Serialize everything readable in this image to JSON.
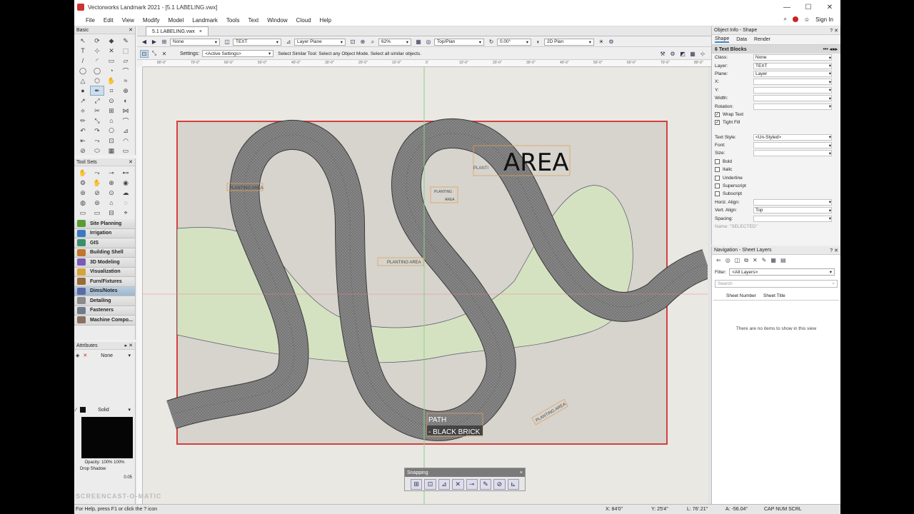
{
  "window": {
    "title": "Vectorworks Landmark 2021 - [5.1 LABELING.vwx]",
    "controls": [
      "—",
      "☐",
      "✕"
    ]
  },
  "menu": [
    "File",
    "Edit",
    "View",
    "Modify",
    "Model",
    "Landmark",
    "Tools",
    "Text",
    "Window",
    "Cloud",
    "Help"
  ],
  "menu_right": {
    "sign_in": "Sign In"
  },
  "document_tab": {
    "label": "5.1 LABELING.vwx",
    "close": "×"
  },
  "view_bar": {
    "class": "None",
    "layer": "TEXT",
    "plane": "Layer Plane",
    "zoom": "62%",
    "view": "Top/Plan",
    "rotation": "0.00°",
    "render": "2D Plan"
  },
  "mode_bar": {
    "settings_label": "Settings:",
    "settings_value": "<Active Settings>",
    "hint": "Select Similar Tool: Select any Object Mode. Select all similar objects."
  },
  "ruler_labels": [
    "80'-0\"",
    "70'-0\"",
    "60'-0\"",
    "50'-0\"",
    "40'-0\"",
    "30'-0\"",
    "20'-0\"",
    "10'-0\"",
    "0'",
    "10'-0\"",
    "20'-0\"",
    "30'-0\"",
    "40'-0\"",
    "50'-0\"",
    "60'-0\"",
    "70'-0\"",
    "80'-0\""
  ],
  "basic_palette": {
    "title": "Basic",
    "tools": [
      "↖",
      "⟳",
      "◆",
      "✎",
      "T",
      "⊹",
      "✕",
      "⬚",
      "/",
      "◜",
      "▭",
      "▱",
      "◯",
      "◯",
      "◔",
      "⌒",
      "△",
      "⬡",
      "✋",
      "≈",
      "●",
      "✒",
      "⌗",
      "⊕",
      "↗",
      "⤢",
      "⊙",
      "◐",
      "⟡",
      "✂",
      "⊞",
      "⋈",
      "✏",
      "⤡",
      "⌂",
      "⌒",
      "↶",
      "↷",
      "⎔",
      "⊿",
      "⇤",
      "⤳",
      "⊡",
      "◠",
      "⊘",
      "⬭",
      "▦",
      "▭"
    ]
  },
  "tool_sets": {
    "title": "Tool Sets",
    "tools": [
      "✋",
      "⤳",
      "⊸",
      "⊷",
      "⚙",
      "✋",
      "⊕",
      "◉",
      "⊛",
      "⊘",
      "⊙",
      "☁",
      "◍",
      "⊜",
      "⌂",
      "◌",
      "▭",
      "▭",
      "⊟",
      "⌖"
    ],
    "items": [
      {
        "label": "Site Planning",
        "color": "#5a9a3a"
      },
      {
        "label": "Irrigation",
        "color": "#3a7abf"
      },
      {
        "label": "GIS",
        "color": "#3b8f6a"
      },
      {
        "label": "Building Shell",
        "color": "#c0772b"
      },
      {
        "label": "3D Modeling",
        "color": "#7a5ab8"
      },
      {
        "label": "Visualization",
        "color": "#d4a43b"
      },
      {
        "label": "Furn/Fixtures",
        "color": "#9a6a3a"
      },
      {
        "label": "Dims/Notes",
        "color": "#5a6aa8"
      },
      {
        "label": "Detailing",
        "color": "#8a8a8a"
      },
      {
        "label": "Fasteners",
        "color": "#707a8a"
      },
      {
        "label": "Machine Compo...",
        "color": "#8a7060"
      }
    ]
  },
  "attributes": {
    "title": "Attributes",
    "fill": "None",
    "pen": "Solid",
    "opacity": "Opacity: 100% 100%",
    "drop_shadow": "Drop Shadow",
    "line_weight": "0.05"
  },
  "drawing": {
    "labels": [
      {
        "text": "PLANTING AREA"
      },
      {
        "text": "PLANTING AREA"
      },
      {
        "text": "PLANTING"
      },
      {
        "text": "AREA"
      },
      {
        "text": "PLANTING AREA"
      },
      {
        "text": "PLANTI"
      }
    ],
    "big_label": "AREA",
    "path_label_1": "PATH",
    "path_label_2": "- BLACK BRICK",
    "colors": {
      "border": "#d44040",
      "planting": "#d4e2c2",
      "path": "#7a7a7a",
      "site": "#d6d4cd"
    }
  },
  "snapping": {
    "title": "Snapping",
    "close": "×",
    "buttons": [
      "⊞",
      "⊡",
      "⊿",
      "✕",
      "⊸",
      "✎",
      "⊘",
      "⊾"
    ]
  },
  "object_info": {
    "title": "Object Info - Shape",
    "tabs": [
      "Shape",
      "Data",
      "Render"
    ],
    "selection": "6 Text Blocks",
    "rows": [
      {
        "label": "Class:",
        "value": "None"
      },
      {
        "label": "Layer:",
        "value": "TEXT"
      },
      {
        "label": "Plane:",
        "value": "Layer"
      },
      {
        "label": "X:",
        "value": ""
      },
      {
        "label": "Y:",
        "value": ""
      },
      {
        "label": "Width:",
        "value": ""
      },
      {
        "label": "Rotation:",
        "value": ""
      }
    ],
    "checks1": [
      {
        "label": "Wrap Text",
        "checked": true
      },
      {
        "label": "Tight Fill",
        "checked": true
      }
    ],
    "rows2": [
      {
        "label": "Text Style:",
        "value": "<Un-Styled>"
      },
      {
        "label": "Font:",
        "value": ""
      },
      {
        "label": "Size:",
        "value": ""
      }
    ],
    "checks2": [
      {
        "label": "Bold",
        "checked": false
      },
      {
        "label": "Italic",
        "checked": false
      },
      {
        "label": "Underline",
        "checked": false
      },
      {
        "label": "Superscript",
        "checked": false
      },
      {
        "label": "Subscript",
        "checked": false
      }
    ],
    "rows3": [
      {
        "label": "Horiz. Align:",
        "value": ""
      },
      {
        "label": "Vert. Align:",
        "value": "Top"
      },
      {
        "label": "Spacing:",
        "value": ""
      }
    ],
    "name_field": "Name: \"SELECTED\""
  },
  "navigation": {
    "title": "Navigation - Sheet Layers",
    "filter_label": "Filter:",
    "filter_value": "<All Layers>",
    "search_placeholder": "Search",
    "col_sheet_number": "Sheet Number",
    "col_sheet_title": "Sheet Title",
    "empty": "There are no items to show in this view"
  },
  "status": {
    "help": "For Help, press F1 or click the ? icon",
    "x": "X: 84'0\"",
    "y": "Y: 25'4\"",
    "l": "L: 76'.21\"",
    "a": "A: -56.04°",
    "keys": "CAP NUM SCRL"
  },
  "watermark": "SCREENCAST-O-MATIC"
}
